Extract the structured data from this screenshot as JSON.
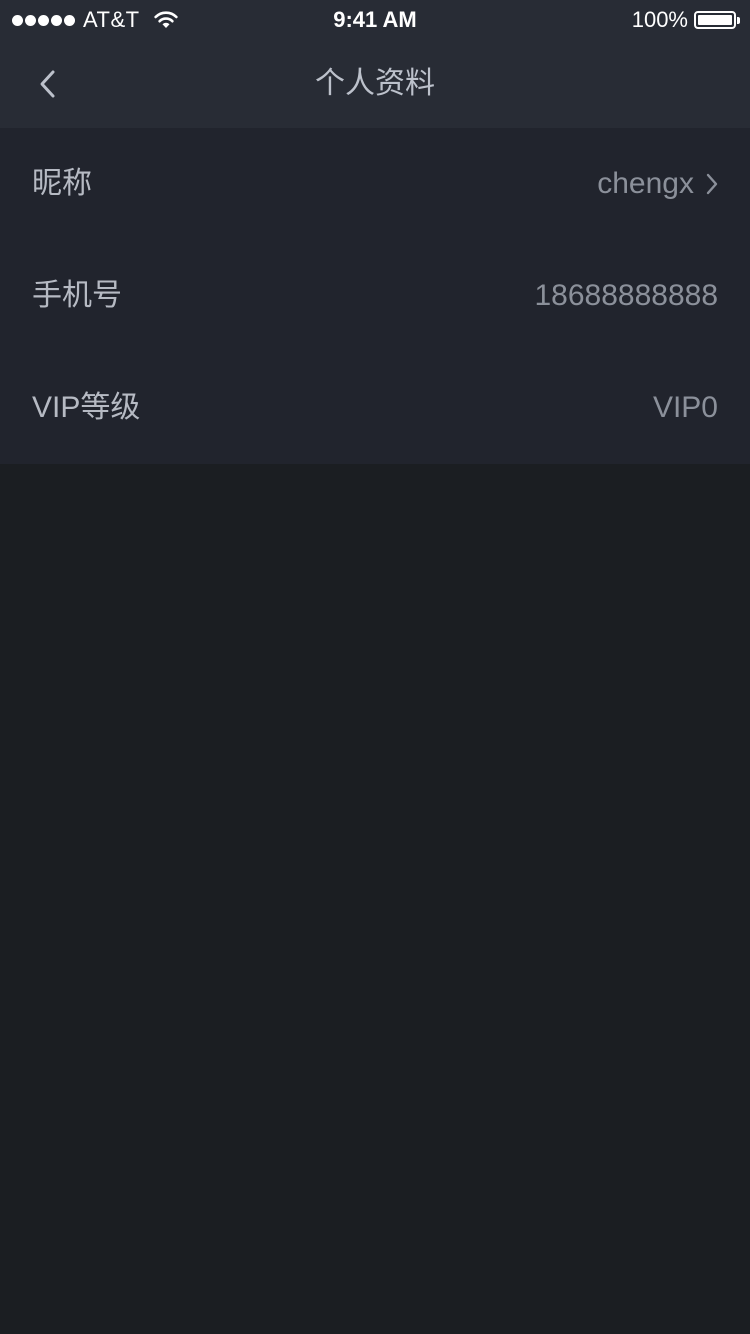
{
  "status_bar": {
    "carrier": "AT&T",
    "time": "9:41 AM",
    "battery_percent": "100%",
    "battery_level": 1.0,
    "signal_bars": 5,
    "icons": [
      "signal-dots-icon",
      "wifi-icon",
      "battery-icon"
    ]
  },
  "nav": {
    "title": "个人资料",
    "back_icon": "chevron-left-icon"
  },
  "profile": {
    "rows": [
      {
        "label": "昵称",
        "value": "chengx",
        "has_chevron": true
      },
      {
        "label": "手机号",
        "value": "18688888888",
        "has_chevron": false
      },
      {
        "label": "VIP等级",
        "value": "VIP0",
        "has_chevron": false
      }
    ]
  },
  "colors": {
    "background": "#1b1e22",
    "bar_background": "#282c35",
    "list_background": "#21242d",
    "label_text": "#b6bac3",
    "value_text": "#8b909a",
    "title_text": "#bcc1cb"
  }
}
